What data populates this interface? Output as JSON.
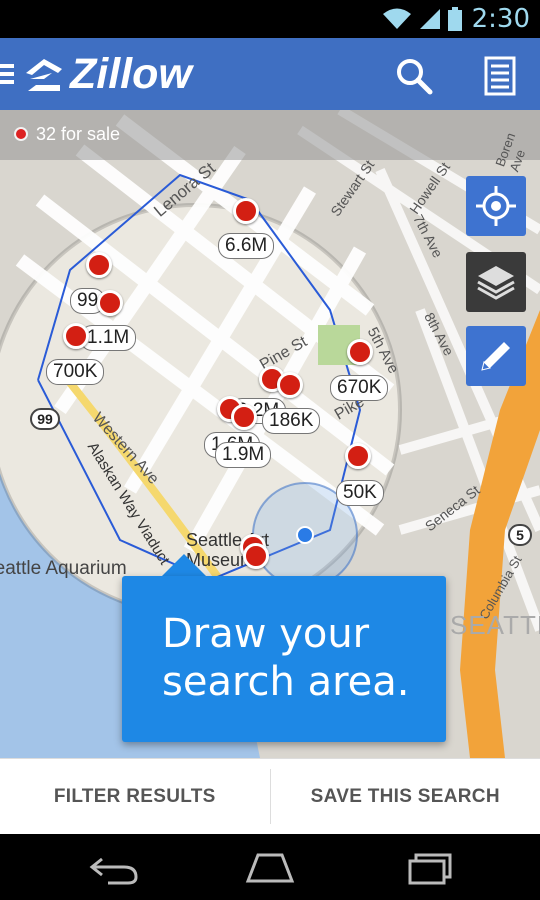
{
  "status_bar": {
    "time": "2:30",
    "icons": [
      "wifi-icon",
      "signal-icon",
      "battery-icon"
    ],
    "accent": "#9fd9ee"
  },
  "app_bar": {
    "title": "Zillow",
    "icons": [
      "menu-icon",
      "zillow-logo-icon",
      "search-icon",
      "list-view-icon"
    ],
    "color": "#3f6fc2"
  },
  "map": {
    "listing_count_text": "32 for sale",
    "street_labels": [
      "Lenora St",
      "Western Ave",
      "Alaskan Way Viaduct",
      "Pine St",
      "Pike St",
      "Stewart St",
      "Howell St",
      "5th Ave",
      "7th Ave",
      "8th Ave",
      "Seneca St",
      "Columbia St",
      "Boren Ave"
    ],
    "places": [
      "Seattle Aquarium",
      "Seattle Art Museum",
      "SEATTLE"
    ],
    "highway_shields": [
      "99",
      "5"
    ],
    "price_labels": [
      "6.6M",
      "99",
      "1.1M",
      "700K",
      "670K",
      "2.2M",
      "186K",
      "1.6M",
      "1.9M",
      "50K"
    ],
    "controls": [
      "my-location-icon",
      "layers-icon",
      "pencil-icon"
    ]
  },
  "tooltip": {
    "text": "Draw your\nsearch area.",
    "color": "#1e88e5"
  },
  "bottom_actions": {
    "filter_label": "FILTER RESULTS",
    "save_label": "SAVE THIS SEARCH"
  },
  "nav_bar": {
    "icons": [
      "back-icon",
      "home-icon",
      "recent-apps-icon"
    ]
  }
}
